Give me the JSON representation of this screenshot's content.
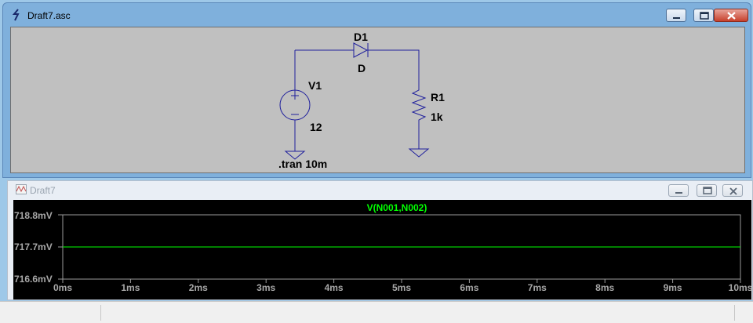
{
  "schematic_window": {
    "title": "Draft7.asc",
    "labels": {
      "diode_ref": "D1",
      "diode_model": "D",
      "source_ref": "V1",
      "source_value": "12",
      "resistor_ref": "R1",
      "resistor_value": "1k",
      "directive": ".tran 10m"
    }
  },
  "waveform_window": {
    "title": "Draft7",
    "trace_label": "V(N001,N002)",
    "trace_color": "#00ff00",
    "y_ticks": [
      "718.8mV",
      "717.7mV",
      "716.6mV"
    ],
    "x_ticks": [
      "0ms",
      "1ms",
      "2ms",
      "3ms",
      "4ms",
      "5ms",
      "6ms",
      "7ms",
      "8ms",
      "9ms",
      "10ms"
    ]
  },
  "chart_data": {
    "type": "line",
    "title": "V(N001,N002)",
    "xlabel": "",
    "ylabel": "",
    "x_unit": "ms",
    "y_unit": "mV",
    "xlim": [
      0,
      10
    ],
    "ylim": [
      716.6,
      718.8
    ],
    "series": [
      {
        "name": "V(N001,N002)",
        "x": [
          0,
          10
        ],
        "y": [
          717.7,
          717.7
        ]
      }
    ],
    "grid": false
  }
}
